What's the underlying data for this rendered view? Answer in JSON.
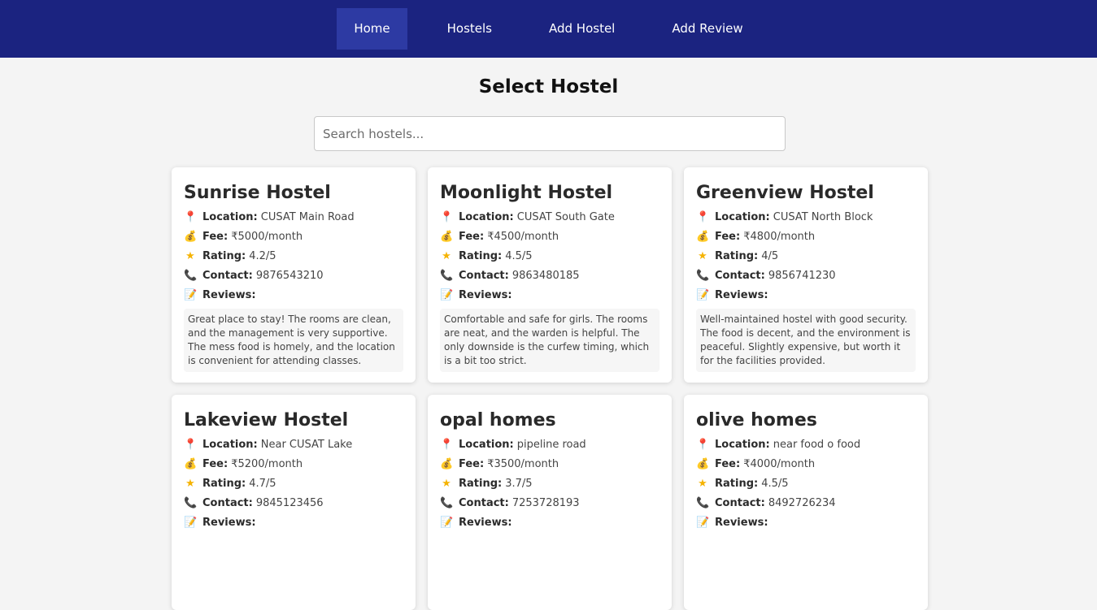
{
  "nav": {
    "items": [
      {
        "label": "Home",
        "active": true
      },
      {
        "label": "Hostels",
        "active": false
      },
      {
        "label": "Add Hostel",
        "active": false
      },
      {
        "label": "Add Review",
        "active": false
      }
    ]
  },
  "page": {
    "title": "Select Hostel"
  },
  "search": {
    "placeholder": "Search hostels...",
    "value": ""
  },
  "labels": {
    "location": "Location:",
    "fee": "Fee:",
    "rating": "Rating:",
    "contact": "Contact:",
    "reviews": "Reviews:"
  },
  "icons": {
    "location": "pin-icon",
    "fee": "money-bag-icon",
    "rating": "star-icon",
    "contact": "phone-icon",
    "reviews": "memo-icon"
  },
  "colors": {
    "navbar": "#1b2380",
    "nav_active": "#2d3aa3",
    "background": "#f4f4f4"
  },
  "hostels": [
    {
      "name": "Sunrise Hostel",
      "location": "CUSAT Main Road",
      "fee": "₹5000/month",
      "rating": "4.2/5",
      "contact": "9876543210",
      "review": "Great place to stay! The rooms are clean, and the management is very supportive. The mess food is homely, and the location is convenient for attending classes."
    },
    {
      "name": "Moonlight Hostel",
      "location": "CUSAT South Gate",
      "fee": "₹4500/month",
      "rating": "4.5/5",
      "contact": "9863480185",
      "review": "Comfortable and safe for girls. The rooms are neat, and the warden is helpful. The only downside is the curfew timing, which is a bit too strict."
    },
    {
      "name": "Greenview Hostel",
      "location": "CUSAT North Block",
      "fee": "₹4800/month",
      "rating": "4/5",
      "contact": "9856741230",
      "review": "Well-maintained hostel with good security. The food is decent, and the environment is peaceful. Slightly expensive, but worth it for the facilities provided."
    },
    {
      "name": "Lakeview Hostel",
      "location": "Near CUSAT Lake",
      "fee": "₹5200/month",
      "rating": "4.7/5",
      "contact": "9845123456",
      "review": ""
    },
    {
      "name": "opal homes",
      "location": "pipeline road",
      "fee": "₹3500/month",
      "rating": "3.7/5",
      "contact": "7253728193",
      "review": ""
    },
    {
      "name": "olive homes",
      "location": "near food o food",
      "fee": "₹4000/month",
      "rating": "4.5/5",
      "contact": "8492726234",
      "review": ""
    }
  ]
}
